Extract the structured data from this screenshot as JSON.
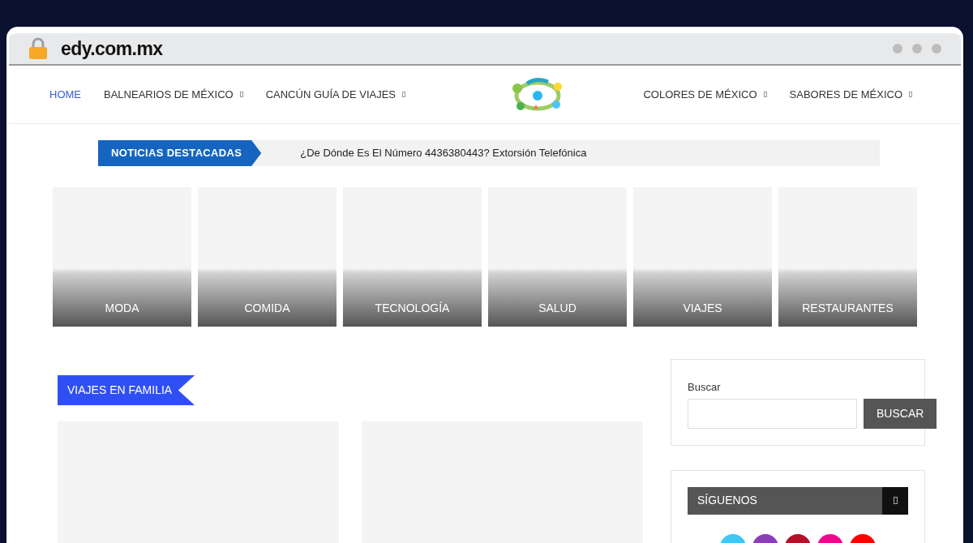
{
  "browser": {
    "url": "edy.com.mx"
  },
  "nav_left": [
    {
      "label": "HOME",
      "selected": true,
      "has_submenu": false
    },
    {
      "label": "BALNEARIOS DE MÉXICO",
      "selected": false,
      "has_submenu": true
    },
    {
      "label": "CANCÚN GUÍA DE VIAJES",
      "selected": false,
      "has_submenu": true
    }
  ],
  "nav_right": [
    {
      "label": "COLORES DE MÉXICO",
      "selected": false,
      "has_submenu": true
    },
    {
      "label": "SABORES DE MÉXICO",
      "selected": false,
      "has_submenu": true
    }
  ],
  "ticker": {
    "label": "NOTICIAS DESTACADAS",
    "headline": "¿De Dónde Es El Número 4436380443? Extorsión Telefónica"
  },
  "categories": [
    "MODA",
    "COMIDA",
    "TECNOLOGÍA",
    "SALUD",
    "VIAJES",
    "RESTAURANTES"
  ],
  "section": {
    "title": "VIAJES EN FAMILIA"
  },
  "search": {
    "label": "Buscar",
    "button": "BUSCAR"
  },
  "follow": {
    "title": "SÍGUENOS",
    "social": [
      {
        "color": "#3ec6f5"
      },
      {
        "color": "#8a3fb8"
      },
      {
        "color": "#b5102a"
      },
      {
        "color": "#f0088c"
      },
      {
        "color": "#ff0000"
      }
    ]
  }
}
